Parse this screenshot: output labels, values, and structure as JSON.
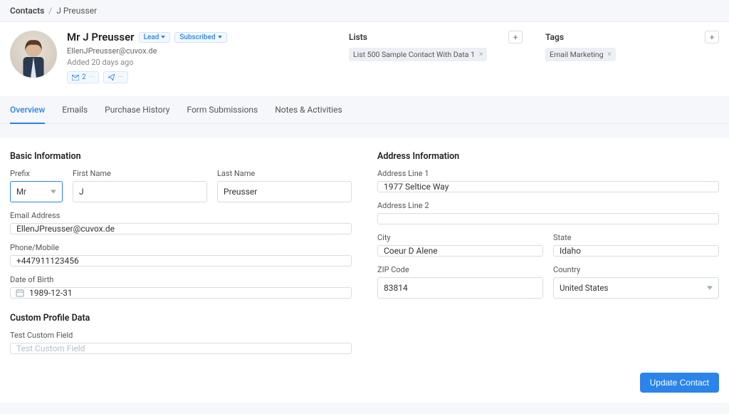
{
  "breadcrumb": {
    "root": "Contacts",
    "sep": "/",
    "current": "J Preusser"
  },
  "profile": {
    "name": "Mr J Preusser",
    "status_label": "Lead",
    "subscribe_label": "Subscribed",
    "email": "EllenJPreusser@cuvox.de",
    "added": "Added 20 days ago",
    "chip_email_count": "2"
  },
  "lists": {
    "title": "Lists",
    "items": [
      "List 500 Sample Contact With Data 1"
    ]
  },
  "tags": {
    "title": "Tags",
    "items": [
      "Email Marketing"
    ]
  },
  "tabs": [
    "Overview",
    "Emails",
    "Purchase History",
    "Form Submissions",
    "Notes & Activities"
  ],
  "active_tab": 0,
  "sections": {
    "basic_title": "Basic Information",
    "address_title": "Address Information",
    "custom_title": "Custom Profile Data"
  },
  "fields": {
    "prefix": {
      "label": "Prefix",
      "value": "Mr"
    },
    "first_name": {
      "label": "First Name",
      "value": "J"
    },
    "last_name": {
      "label": "Last Name",
      "value": "Preusser"
    },
    "email": {
      "label": "Email Address",
      "value": "EllenJPreusser@cuvox.de"
    },
    "phone": {
      "label": "Phone/Mobile",
      "value": "+447911123456"
    },
    "dob": {
      "label": "Date of Birth",
      "value": "1989-12-31"
    },
    "addr1": {
      "label": "Address Line 1",
      "value": "1977 Seltice Way"
    },
    "addr2": {
      "label": "Address Line 2",
      "value": ""
    },
    "city": {
      "label": "City",
      "value": "Coeur D Alene"
    },
    "state": {
      "label": "State",
      "value": "Idaho"
    },
    "zip": {
      "label": "ZIP Code",
      "value": "83814"
    },
    "country": {
      "label": "Country",
      "value": "United States"
    },
    "custom1": {
      "label": "Test Custom Field",
      "placeholder": "Test Custom Field",
      "value": ""
    }
  },
  "buttons": {
    "update": "Update Contact"
  }
}
